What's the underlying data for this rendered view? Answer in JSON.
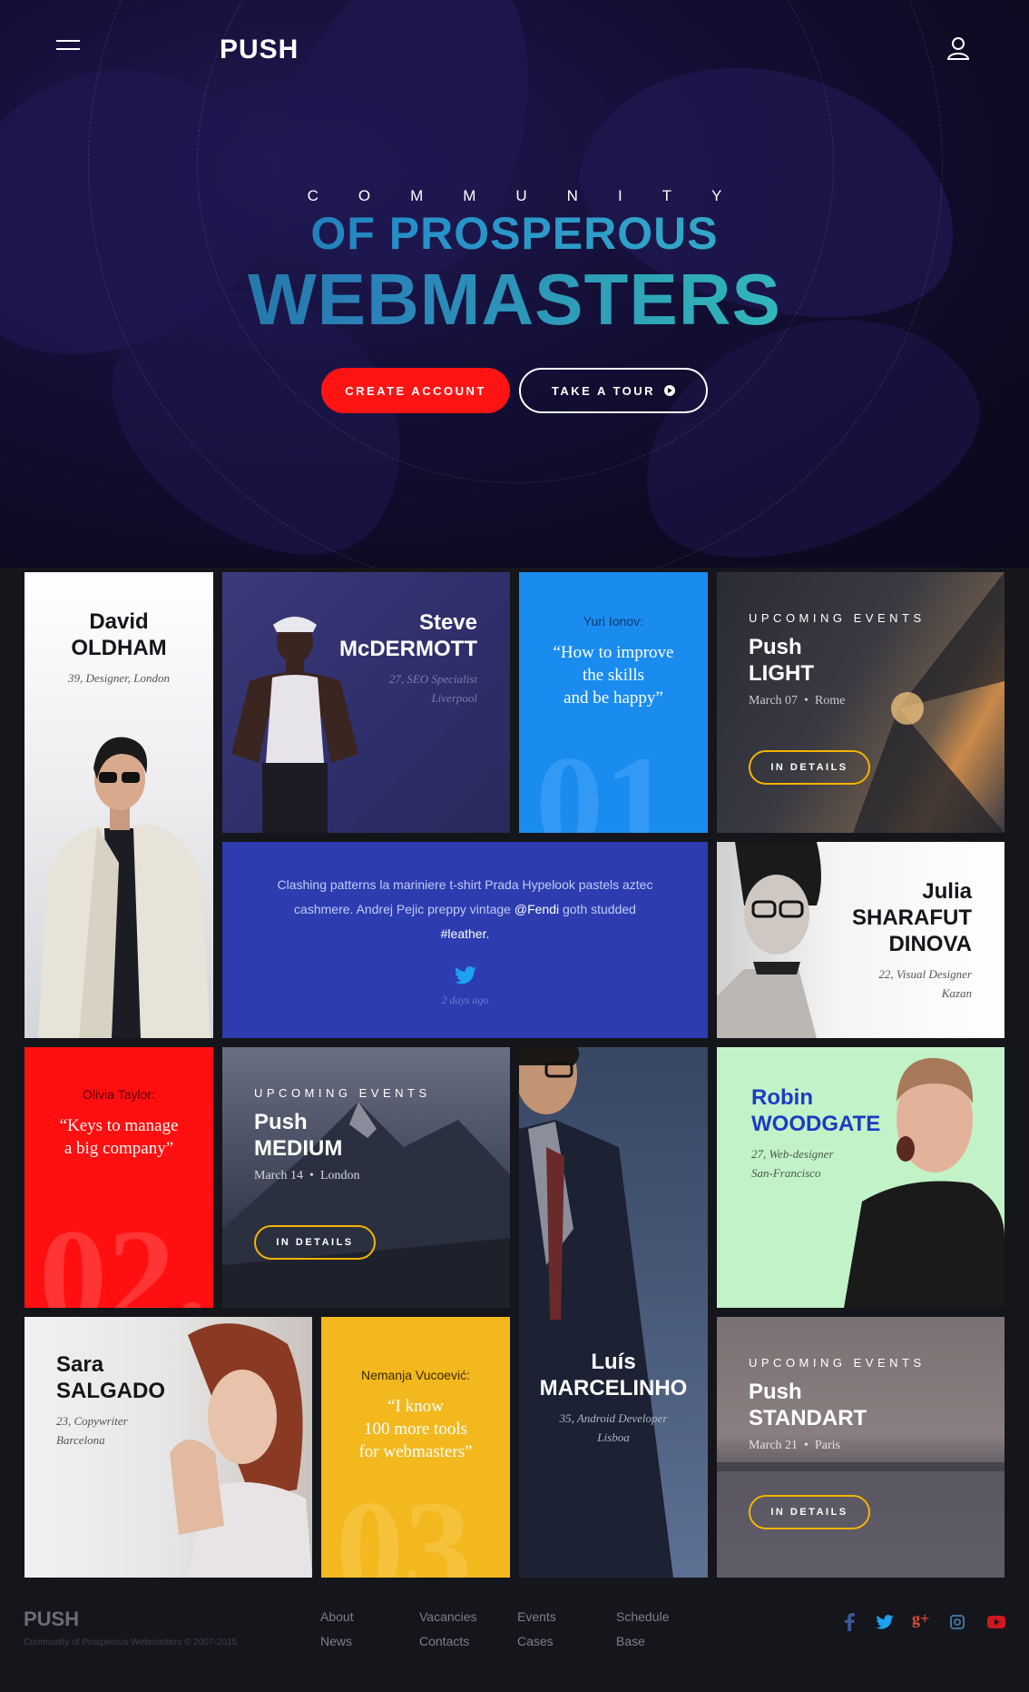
{
  "header": {
    "logo": "PUSH"
  },
  "hero": {
    "kicker": "COMMUNITY",
    "title_line1": "OF PROSPEROUS",
    "title_line2": "WEBMASTERS",
    "create_label": "CREATE ACCOUNT",
    "tour_label": "TAKE A TOUR"
  },
  "profiles": {
    "david": {
      "first": "David",
      "last": "OLDHAM",
      "meta": "39, Designer, London"
    },
    "steve": {
      "first": "Steve",
      "last": "McDERMOTT",
      "meta1": "27, SEO Specialist",
      "meta2": "Liverpool"
    },
    "julia": {
      "first": "Julia",
      "last1": "SHARAFUT",
      "last2": "DINOVA",
      "meta1": "22, Visual Designer",
      "meta2": "Kazan"
    },
    "robin": {
      "first": "Robin",
      "last": "WOODGATE",
      "meta1": "27, Web-designer",
      "meta2": "San-Francisco"
    },
    "sara": {
      "first": "Sara",
      "last": "SALGADO",
      "meta1": "23, Copywriter",
      "meta2": "Barcelona"
    },
    "luis": {
      "first": "Luís",
      "last": "MARCELINHO",
      "meta1": "35, Android Developer",
      "meta2": "Lisboa"
    }
  },
  "quotes": {
    "q1": {
      "author": "Yuri Ionov:",
      "l1": "“How to improve",
      "l2": "the skills",
      "l3": "and be happy”",
      "number": "01",
      "color": "#1a8cf0"
    },
    "q2": {
      "author": "Olivia Taylor:",
      "l1": "“Keys to manage",
      "l2": "a big company”",
      "number": "02.",
      "color": "#ff0f0f"
    },
    "q3": {
      "author": "Nemanja Vucoević:",
      "l1": "“I know",
      "l2": "100 more tools",
      "l3": "for webmasters”",
      "number": "03",
      "color": "#f2b81e"
    }
  },
  "events": {
    "label": "UPCOMING EVENTS",
    "details_label": "IN DETAILS",
    "light": {
      "push": "Push",
      "name": "LIGHT",
      "date": "March 07",
      "city": "Rome"
    },
    "medium": {
      "push": "Push",
      "name": "MEDIUM",
      "date": "March 14",
      "city": "London"
    },
    "standart": {
      "push": "Push",
      "name": "STANDART",
      "date": "March 21",
      "city": "Paris"
    }
  },
  "tweet": {
    "line1": "Clashing patterns la mariniere t-shirt Prada Hypelook pastels aztec",
    "line2a": "cashmere. Andrej Pejic preppy vintage ",
    "handle": "@Fendi",
    "line2b": " goth studded",
    "line3": "#leather.",
    "time": "2 days ago"
  },
  "footer": {
    "logo": "PUSH",
    "copyright": "Community of Prosperous Webmasters © 2007-2015",
    "links": [
      "About",
      "News",
      "Vacancies",
      "Contacts",
      "Events",
      "Cases",
      "Schedule",
      "Base"
    ],
    "social_colors": {
      "facebook": "#3b5998",
      "twitter": "#1da1f2",
      "googleplus": "#dd4b39",
      "instagram": "#3f729b",
      "youtube": "#cc181e"
    }
  }
}
